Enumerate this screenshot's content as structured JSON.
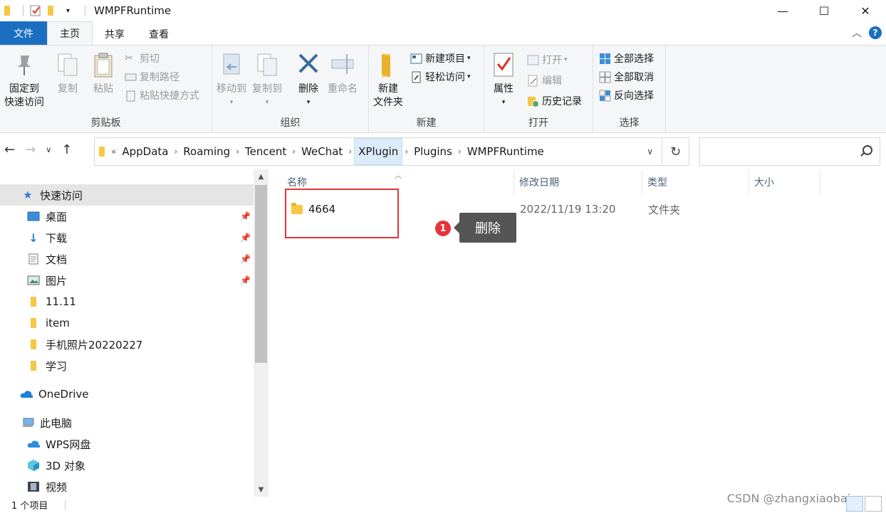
{
  "window": {
    "title": "WMPFRuntime",
    "controls": [
      "—",
      "☐",
      "✕"
    ]
  },
  "tabs": [
    {
      "label": "文件"
    },
    {
      "label": "主页"
    },
    {
      "label": "共享"
    },
    {
      "label": "查看"
    }
  ],
  "ribbon": {
    "clipboard": {
      "label": "剪贴板",
      "pin": "固定到",
      "pin2": "快速访问",
      "copy": "复制",
      "paste": "粘贴",
      "cut": "剪切",
      "copy_path": "复制路径",
      "paste_shortcut": "粘贴快捷方式"
    },
    "organize": {
      "label": "组织",
      "move_to": "移动到",
      "copy_to": "复制到",
      "delete": "删除",
      "rename": "重命名"
    },
    "new": {
      "label": "新建",
      "new_folder": "新建",
      "new_folder2": "文件夹",
      "new_item": "新建项目",
      "easy_access": "轻松访问"
    },
    "open": {
      "label": "打开",
      "properties": "属性",
      "open": "打开",
      "edit": "编辑",
      "history": "历史记录"
    },
    "select": {
      "label": "选择",
      "select_all": "全部选择",
      "select_none": "全部取消",
      "invert": "反向选择"
    }
  },
  "address": {
    "prefix": "«",
    "crumbs": [
      "AppData",
      "Roaming",
      "Tencent",
      "WeChat",
      "XPlugin",
      "Plugins",
      "WMPFRuntime"
    ],
    "highlighted": "XPlugin",
    "search_placeholder": ""
  },
  "nav": {
    "quick_access": "快速访问",
    "items": [
      "桌面",
      "下载",
      "文档",
      "图片",
      "11.11",
      "item",
      "手机照片20220227",
      "学习"
    ],
    "onedrive": "OneDrive",
    "this_pc": "此电脑",
    "pc_items": [
      "WPS网盘",
      "3D 对象",
      "视频"
    ]
  },
  "columns": {
    "name": "名称",
    "date": "修改日期",
    "type": "类型",
    "size": "大小"
  },
  "files": [
    {
      "name": "4664",
      "date": "2022/11/19 13:20",
      "type": "文件夹",
      "size": ""
    }
  ],
  "annotation": {
    "number": "1",
    "text": "删除",
    "color": "#e8323a"
  },
  "status": {
    "count": "1 个项目"
  },
  "watermark": "CSDN @zhangxiaobai",
  "colors": {
    "accent": "#1a6fc2",
    "highlight": "#e0343a"
  }
}
